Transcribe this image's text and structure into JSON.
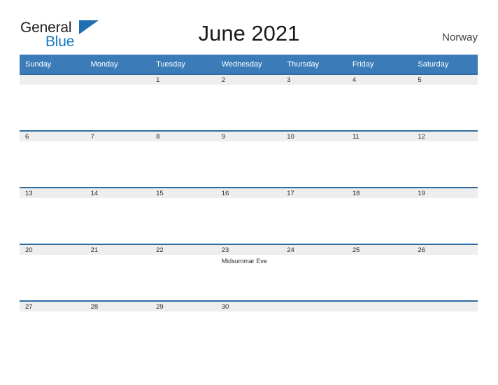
{
  "brand": {
    "name_top": "General",
    "name_bottom": "Blue",
    "flag_icon": "blue-triangle-flag",
    "accent_color": "#1279c6"
  },
  "header": {
    "title": "June 2021",
    "region": "Norway"
  },
  "theme": {
    "header_blue": "#3b7cb8",
    "date_band": "#eeeeee",
    "date_band_border": "#2e6da4"
  },
  "calendar": {
    "month": "June",
    "year": "2021",
    "weekday_headers": [
      "Sunday",
      "Monday",
      "Tuesday",
      "Wednesday",
      "Thursday",
      "Friday",
      "Saturday"
    ],
    "weeks": [
      [
        {
          "date": "",
          "events": []
        },
        {
          "date": "",
          "events": []
        },
        {
          "date": "1",
          "events": []
        },
        {
          "date": "2",
          "events": []
        },
        {
          "date": "3",
          "events": []
        },
        {
          "date": "4",
          "events": []
        },
        {
          "date": "5",
          "events": []
        }
      ],
      [
        {
          "date": "6",
          "events": []
        },
        {
          "date": "7",
          "events": []
        },
        {
          "date": "8",
          "events": []
        },
        {
          "date": "9",
          "events": []
        },
        {
          "date": "10",
          "events": []
        },
        {
          "date": "11",
          "events": []
        },
        {
          "date": "12",
          "events": []
        }
      ],
      [
        {
          "date": "13",
          "events": []
        },
        {
          "date": "14",
          "events": []
        },
        {
          "date": "15",
          "events": []
        },
        {
          "date": "16",
          "events": []
        },
        {
          "date": "17",
          "events": []
        },
        {
          "date": "18",
          "events": []
        },
        {
          "date": "19",
          "events": []
        }
      ],
      [
        {
          "date": "20",
          "events": []
        },
        {
          "date": "21",
          "events": []
        },
        {
          "date": "22",
          "events": []
        },
        {
          "date": "23",
          "events": [
            "Midsummar Eve"
          ]
        },
        {
          "date": "24",
          "events": []
        },
        {
          "date": "25",
          "events": []
        },
        {
          "date": "26",
          "events": []
        }
      ],
      [
        {
          "date": "27",
          "events": []
        },
        {
          "date": "28",
          "events": []
        },
        {
          "date": "29",
          "events": []
        },
        {
          "date": "30",
          "events": []
        },
        {
          "date": "",
          "events": []
        },
        {
          "date": "",
          "events": []
        },
        {
          "date": "",
          "events": []
        }
      ]
    ]
  }
}
